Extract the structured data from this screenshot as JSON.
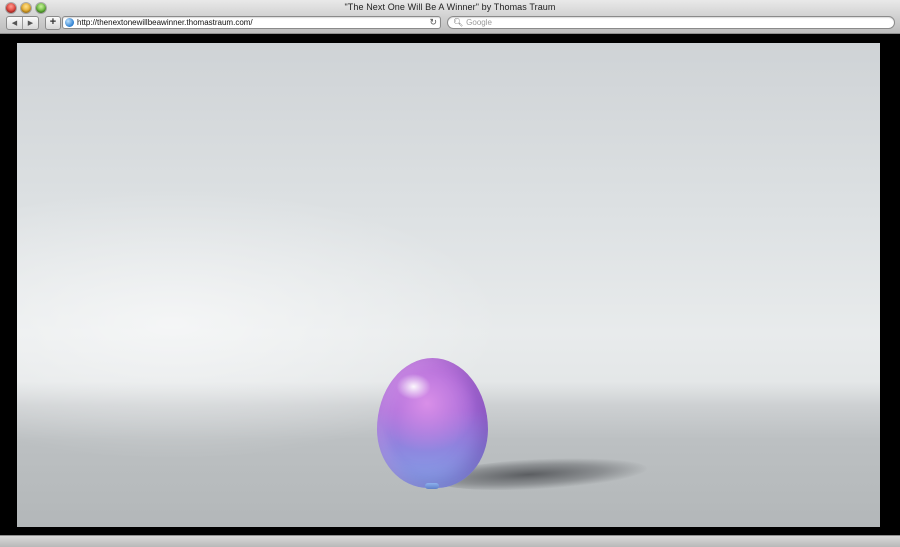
{
  "window": {
    "title": "\"The Next One Will Be A Winner\" by Thomas Traum"
  },
  "toolbar": {
    "back_icon": "left-triangle-icon",
    "forward_icon": "right-triangle-icon",
    "add_label": "+",
    "url": "http://thenextonewillbeawinner.thomastraum.com/",
    "reload_icon": "reload-icon",
    "search_placeholder": "Google"
  },
  "scene": {
    "balloon_color": "#a96ad8",
    "background_color": "#e4e7e8"
  }
}
